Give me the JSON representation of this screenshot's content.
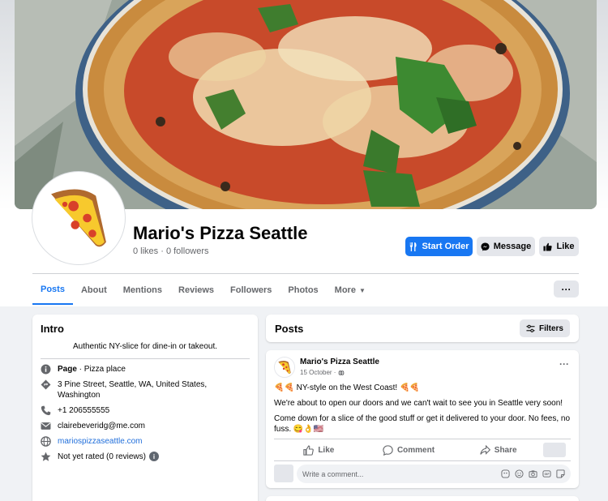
{
  "page": {
    "name": "Mario's Pizza Seattle",
    "stats": "0 likes · 0 followers"
  },
  "cover": {
    "description_icon": "pizza-photo"
  },
  "buttons": {
    "start_order": "Start Order",
    "message": "Message",
    "like": "Like",
    "more": "···"
  },
  "tabs": [
    {
      "label": "Posts",
      "active": true
    },
    {
      "label": "About"
    },
    {
      "label": "Mentions"
    },
    {
      "label": "Reviews"
    },
    {
      "label": "Followers"
    },
    {
      "label": "Photos"
    },
    {
      "label": "More"
    }
  ],
  "intro": {
    "title": "Intro",
    "bio": "Authentic NY-slice for dine-in or takeout.",
    "page_label": "Page",
    "page_category": " · Pizza place",
    "address": "3 Pine Street, Seattle, WA, United States, Washington",
    "phone": "+1 206555555",
    "email": "clairebeveridg@me.com",
    "website": "mariospizzaseattle.com",
    "rating": "Not yet rated (0 reviews)",
    "rating_info": "i"
  },
  "posts_section": {
    "title": "Posts",
    "filters": "Filters"
  },
  "post": {
    "author": "Mario's Pizza Seattle",
    "date": "15 October ·",
    "more": "···",
    "line1": "🍕🍕 NY-style on the West Coast! 🍕🍕",
    "line2": "We're about to open our doors and we can't wait to see you in Seattle very soon!",
    "line3": "Come down for a slice of the good stuff or get it delivered to your door. No fees, no fuss. 😋👌🇺🇸",
    "like": "Like",
    "comment": "Comment",
    "share": "Share",
    "comment_placeholder": "Write a comment..."
  },
  "colors": {
    "accent": "#1877f2",
    "link": "#216fdb",
    "background": "#f0f2f5"
  }
}
